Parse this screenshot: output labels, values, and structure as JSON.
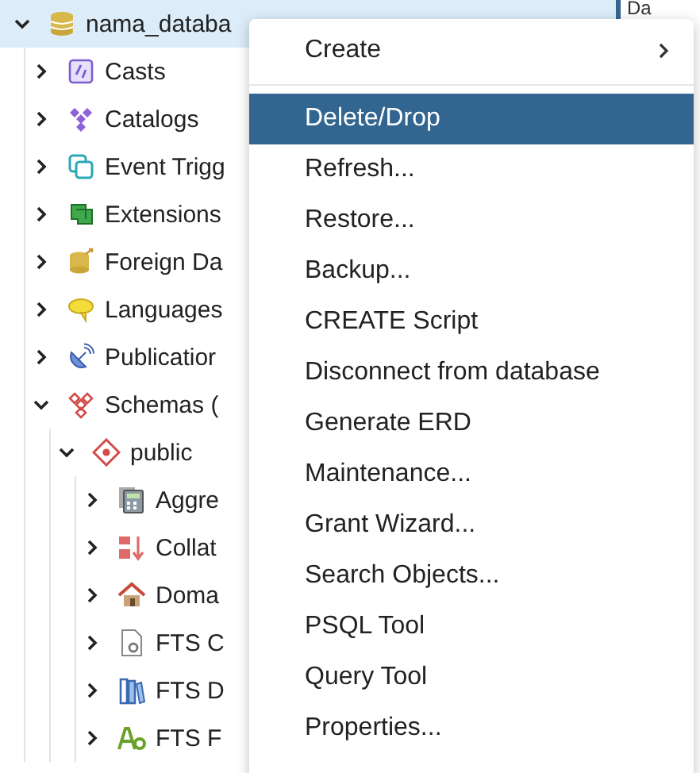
{
  "tree": [
    {
      "label": "nama_databa",
      "expanded": true,
      "selected": true,
      "children": [
        {
          "label": "Casts",
          "expanded": false,
          "selected": false
        },
        {
          "label": "Catalogs",
          "expanded": false,
          "selected": false
        },
        {
          "label": "Event Trigg",
          "expanded": false,
          "selected": false
        },
        {
          "label": "Extensions",
          "expanded": false,
          "selected": false
        },
        {
          "label": "Foreign Da",
          "expanded": false,
          "selected": false
        },
        {
          "label": "Languages",
          "expanded": false,
          "selected": false
        },
        {
          "label": "Publicatior",
          "expanded": false,
          "selected": false
        },
        {
          "label": "Schemas (",
          "expanded": true,
          "selected": false,
          "children": [
            {
              "label": "public",
              "expanded": true,
              "selected": false,
              "children": [
                {
                  "label": "Aggre",
                  "expanded": false,
                  "selected": false
                },
                {
                  "label": "Collat",
                  "expanded": false,
                  "selected": false
                },
                {
                  "label": "Doma",
                  "expanded": false,
                  "selected": false
                },
                {
                  "label": "FTS C",
                  "expanded": false,
                  "selected": false
                },
                {
                  "label": "FTS D",
                  "expanded": false,
                  "selected": false
                },
                {
                  "label": "FTS F",
                  "expanded": false,
                  "selected": false
                }
              ]
            }
          ]
        }
      ]
    }
  ],
  "side_tab": {
    "label": "Da"
  },
  "context_menu": [
    {
      "kind": "item",
      "label": "Create",
      "submenu": true,
      "selected": false
    },
    {
      "kind": "divider"
    },
    {
      "kind": "item",
      "label": "Delete/Drop",
      "submenu": false,
      "selected": true
    },
    {
      "kind": "item",
      "label": "Refresh...",
      "submenu": false,
      "selected": false
    },
    {
      "kind": "item",
      "label": "Restore...",
      "submenu": false,
      "selected": false
    },
    {
      "kind": "item",
      "label": "Backup...",
      "submenu": false,
      "selected": false
    },
    {
      "kind": "item",
      "label": "CREATE Script",
      "submenu": false,
      "selected": false
    },
    {
      "kind": "item",
      "label": "Disconnect from database",
      "submenu": false,
      "selected": false
    },
    {
      "kind": "item",
      "label": "Generate ERD",
      "submenu": false,
      "selected": false
    },
    {
      "kind": "item",
      "label": "Maintenance...",
      "submenu": false,
      "selected": false
    },
    {
      "kind": "item",
      "label": "Grant Wizard...",
      "submenu": false,
      "selected": false
    },
    {
      "kind": "item",
      "label": "Search Objects...",
      "submenu": false,
      "selected": false
    },
    {
      "kind": "item",
      "label": "PSQL Tool",
      "submenu": false,
      "selected": false
    },
    {
      "kind": "item",
      "label": "Query Tool",
      "submenu": false,
      "selected": false
    },
    {
      "kind": "item",
      "label": "Properties...",
      "submenu": false,
      "selected": false
    }
  ]
}
